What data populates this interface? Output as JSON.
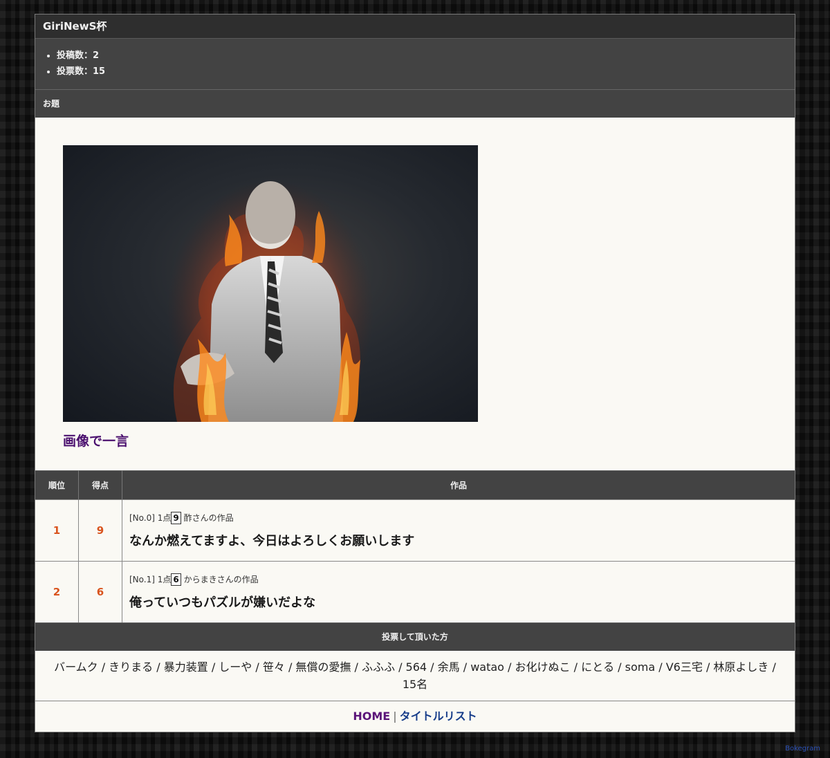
{
  "header": {
    "title": "GiriNewS杯"
  },
  "stats": {
    "posts": "投稿数：2",
    "votes": "投票数：15"
  },
  "odai": {
    "heading": "お題",
    "caption": "画像で一言"
  },
  "ranking": {
    "headers": {
      "rank": "順位",
      "score": "得点",
      "work": "作品"
    },
    "rows": [
      {
        "rank": "1",
        "score": "9",
        "meta_prefix": "[No.0] 1点",
        "score_box": "9",
        "author": "酢さんの作品",
        "phrase": "なんか燃えてますよ、今日はよろしくお願いします"
      },
      {
        "rank": "2",
        "score": "6",
        "meta_prefix": "[No.1] 1点",
        "score_box": "6",
        "author": "からまきさんの作品",
        "phrase": "俺っていつもパズルが嫌いだよな"
      }
    ]
  },
  "voters": {
    "heading": "投票して頂いた方",
    "list": "バームク / きりまる / 暴力装置 / しーや / 笹々 / 無償の愛撫 / ふふふ / 564 / 余馬 / watao / お化けぬこ / にとる / soma / V6三宅 / 林原よしき /",
    "count": "15名"
  },
  "nav": {
    "home": "HOME",
    "separator": "|",
    "title_list": "タイトルリスト"
  },
  "credit": "Bokegram"
}
